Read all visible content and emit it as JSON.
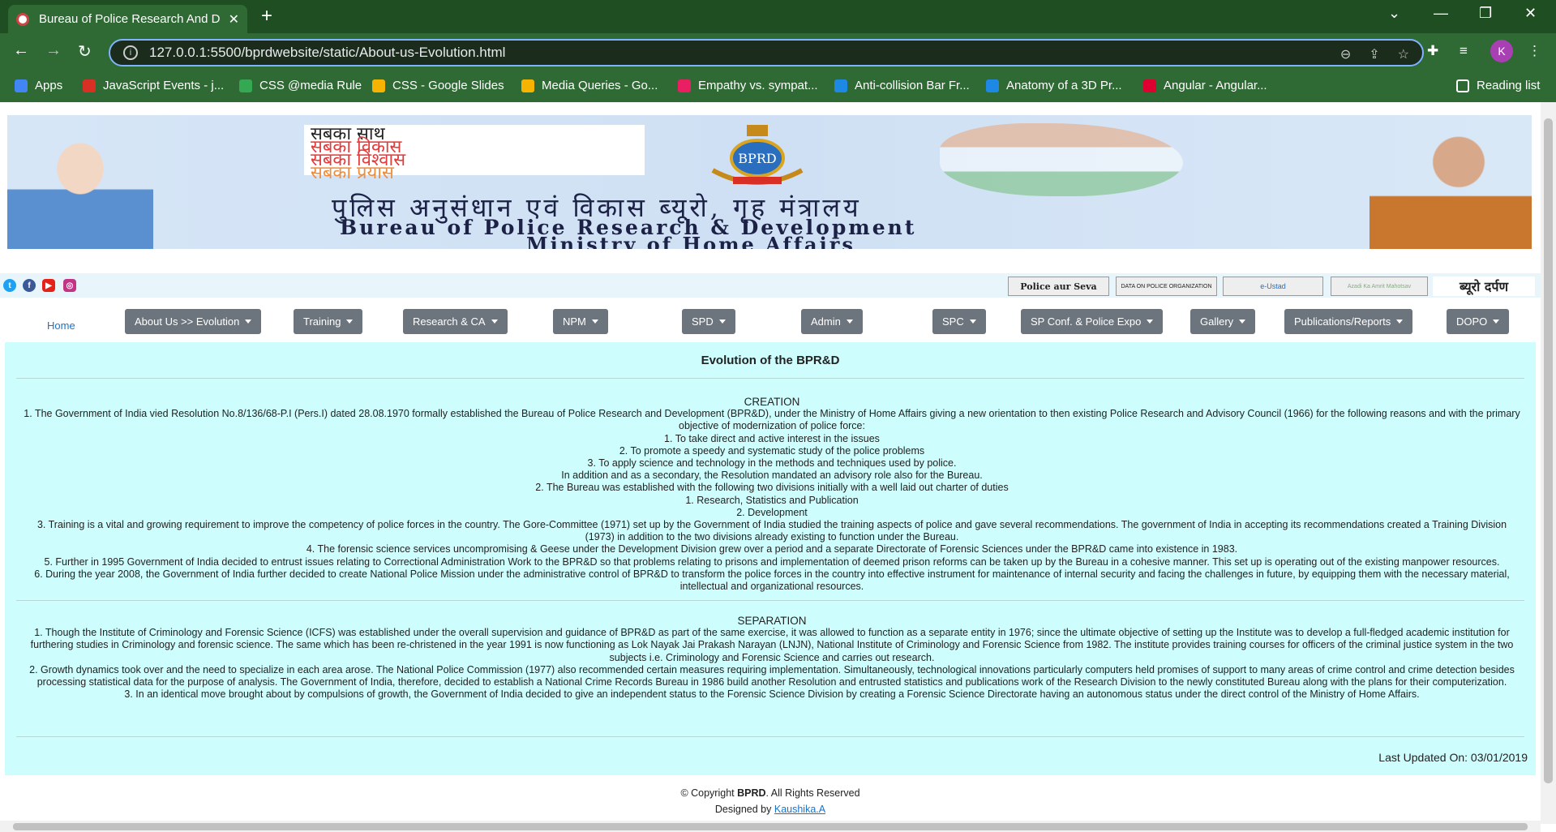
{
  "browser": {
    "tab_title": "Bureau of Police Research And D",
    "url": "127.0.0.1:5500/bprdwebsite/static/About-us-Evolution.html",
    "profile_initial": "K",
    "bookmarks": [
      {
        "label": "Apps",
        "color": "#4285f4"
      },
      {
        "label": "JavaScript Events - j...",
        "color": "#d93025"
      },
      {
        "label": "CSS @media Rule",
        "color": "#34a853"
      },
      {
        "label": "CSS - Google Slides",
        "color": "#f6b400"
      },
      {
        "label": "Media Queries - Go...",
        "color": "#f6b400"
      },
      {
        "label": "Empathy vs. sympat...",
        "color": "#e91e63"
      },
      {
        "label": "Anti-collision Bar Fr...",
        "color": "#1e88e5"
      },
      {
        "label": "Anatomy of a 3D Pr...",
        "color": "#1e88e5"
      },
      {
        "label": "Angular - Angular...",
        "color": "#dd0031"
      }
    ],
    "reading_list": "Reading list"
  },
  "banner": {
    "slogan_lines": [
      "सबका साथ",
      "सबका विकास",
      "सबका विश्वास",
      "सबका प्रयास"
    ],
    "emblem_text": "BPRD",
    "hindi_title": "पुलिस अनुसंधान एवं विकास ब्यूरो, गृह मंत्रालय",
    "english_title": "Bureau of Police Research & Development",
    "ministry": "Ministry of Home Affairs"
  },
  "partners": [
    "Police aur Seva",
    "DATA ON POLICE ORGANIZATION",
    "e-Ustad",
    "Azadi Ka Amrit Mahotsav",
    "ब्यूरो दर्पण"
  ],
  "menu": {
    "home": "Home",
    "dropdowns": [
      "About Us >> Evolution",
      "Training",
      "Research & CA",
      "NPM",
      "SPD",
      "Admin",
      "SPC",
      "SP Conf. & Police Expo",
      "Gallery",
      "Publications/Reports",
      "DOPO"
    ]
  },
  "content": {
    "title": "Evolution of the BPR&D",
    "creation_heading": "CREATION",
    "creation_lines": [
      "1. The Government of India vied Resolution No.8/136/68-P.I (Pers.I) dated 28.08.1970 formally established the Bureau of Police Research and Development (BPR&D), under the Ministry of Home Affairs giving a new orientation to then existing Police Research and Advisory Council (1966) for the following reasons and with the primary objective of modernization of police force:",
      "1. To take direct and active interest in the issues",
      "2. To promote a speedy and systematic study of the police problems",
      "3. To apply science and technology in the methods and techniques used by police.",
      "In addition and as a secondary, the Resolution mandated an advisory role also for the Bureau.",
      "2. The Bureau was established with the following two divisions initially with a well laid out charter of duties",
      "1. Research, Statistics and Publication",
      "2. Development",
      "3. Training is a vital and growing requirement to improve the competency of police forces in the country. The Gore-Committee (1971) set up by the Government of India studied the training aspects of police and gave several recommendations. The government of India in accepting its recommendations created a Training Division (1973) in addition to the two divisions already existing to function under the Bureau.",
      "4. The forensic science services uncompromising & Geese under the Development Division grew over a period and a separate Directorate of Forensic Sciences under the BPR&D came into existence in 1983.",
      "5. Further in 1995 Government of India decided to entrust issues relating to Correctional Administration Work to the BPR&D so that problems relating to prisons and implementation of deemed prison reforms can be taken up by the Bureau in a cohesive manner. This set up is operating out of the existing manpower resources.",
      "6. During the year 2008, the Government of India further decided to create National Police Mission under the administrative control of BPR&D to transform the police forces in the country into effective instrument for maintenance of internal security and facing the challenges in future, by equipping them with the necessary material, intellectual and organizational resources."
    ],
    "separation_heading": "SEPARATION",
    "separation_lines": [
      "1. Though the Institute of Criminology and Forensic Science (ICFS) was established under the overall supervision and guidance of BPR&D as part of the same exercise, it was allowed to function as a separate entity in 1976; since the ultimate objective of setting up the Institute was to develop a full-fledged academic institution for furthering studies in Criminology and forensic science. The same which has been re-christened in the year 1991 is now functioning as Lok Nayak Jai Prakash Narayan (LNJN), National Institute of Criminology and Forensic Science from 1982. The institute provides training courses for officers of the criminal justice system in the two subjects i.e. Criminology and Forensic Science and carries out research.",
      "2. Growth dynamics took over and the need to specialize in each area arose. The National Police Commission (1977) also recommended certain measures requiring implementation. Simultaneously, technological innovations particularly computers held promises of support to many areas of crime control and crime detection besides processing statistical data for the purpose of analysis. The Government of India, therefore, decided to establish a National Crime Records Bureau in 1986 build another Resolution and entrusted statistics and publications work of the Research Division to the newly constituted Bureau along with the plans for their computerization.",
      "3. In an identical move brought about by compulsions of growth, the Government of India decided to give an independent status to the Forensic Science Division by creating a Forensic Science Directorate having an autonomous status under the direct control of the Ministry of Home Affairs."
    ],
    "last_updated": "Last Updated On: 03/01/2019"
  },
  "footer": {
    "copyright_prefix": "© Copyright ",
    "brand": "BPRD",
    "copyright_suffix": ". All Rights Reserved",
    "designed_by": "Designed by ",
    "designer": "Kaushika.A"
  }
}
